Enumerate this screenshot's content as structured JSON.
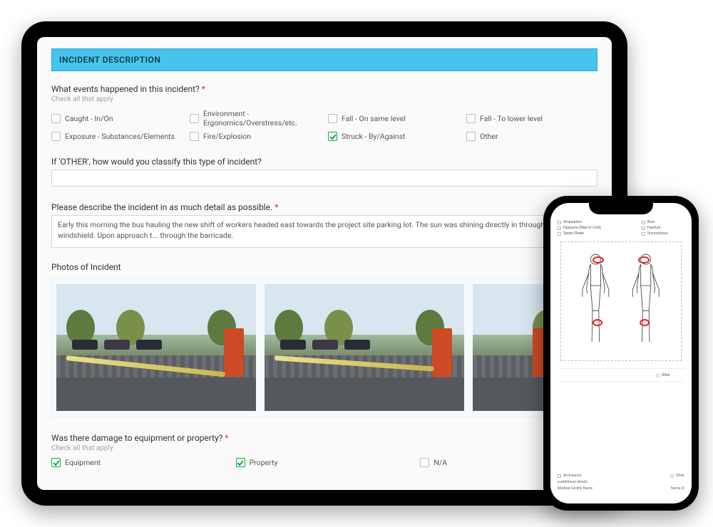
{
  "section_title": "INCIDENT DESCRIPTION",
  "q_events": {
    "label": "What events happened in this incident?",
    "hint": "Check all that apply",
    "options": [
      {
        "label": "Caught - In/On",
        "checked": false
      },
      {
        "label": "Environment - Ergonomics/Overstress/etc.",
        "checked": false
      },
      {
        "label": "Fall - On same level",
        "checked": false
      },
      {
        "label": "Fall - To lower level",
        "checked": false
      },
      {
        "label": "Exposure - Substances/Elements",
        "checked": false
      },
      {
        "label": "Fire/Explosion",
        "checked": false
      },
      {
        "label": "Struck - By/Against",
        "checked": true
      },
      {
        "label": "Other",
        "checked": false
      }
    ]
  },
  "q_other": {
    "label": "If 'OTHER', how would you classify this type of incident?",
    "value": ""
  },
  "q_describe": {
    "label": "Please describe the incident in as much detail as possible.",
    "value": "Early this morning the bus hauling the new shift of workers headed east towards the project site parking lot. The sun was shining directly in through the windshield. Upon approach t... through the barricade."
  },
  "photos": {
    "label": "Photos of Incident"
  },
  "q_damage": {
    "label": "Was there damage to equipment or property?",
    "hint": "Check all that apply",
    "options": [
      {
        "label": "Equipment",
        "checked": true
      },
      {
        "label": "Property",
        "checked": true
      },
      {
        "label": "N/A",
        "checked": false
      }
    ]
  },
  "phone": {
    "injury_types": [
      {
        "label": "Amputation",
        "r": "Burn"
      },
      {
        "label": "Exposure (Heat or Cold)",
        "r": "Fracture"
      },
      {
        "label": "Sprain/Strain",
        "r": "Unconscious"
      }
    ],
    "other_label": "Other",
    "ambulance_label": "Ambulance",
    "ambulance_other": "Other",
    "additional_details": "e additional details.",
    "facility_label": "Medical Facility Name",
    "name_label": "Name of"
  }
}
